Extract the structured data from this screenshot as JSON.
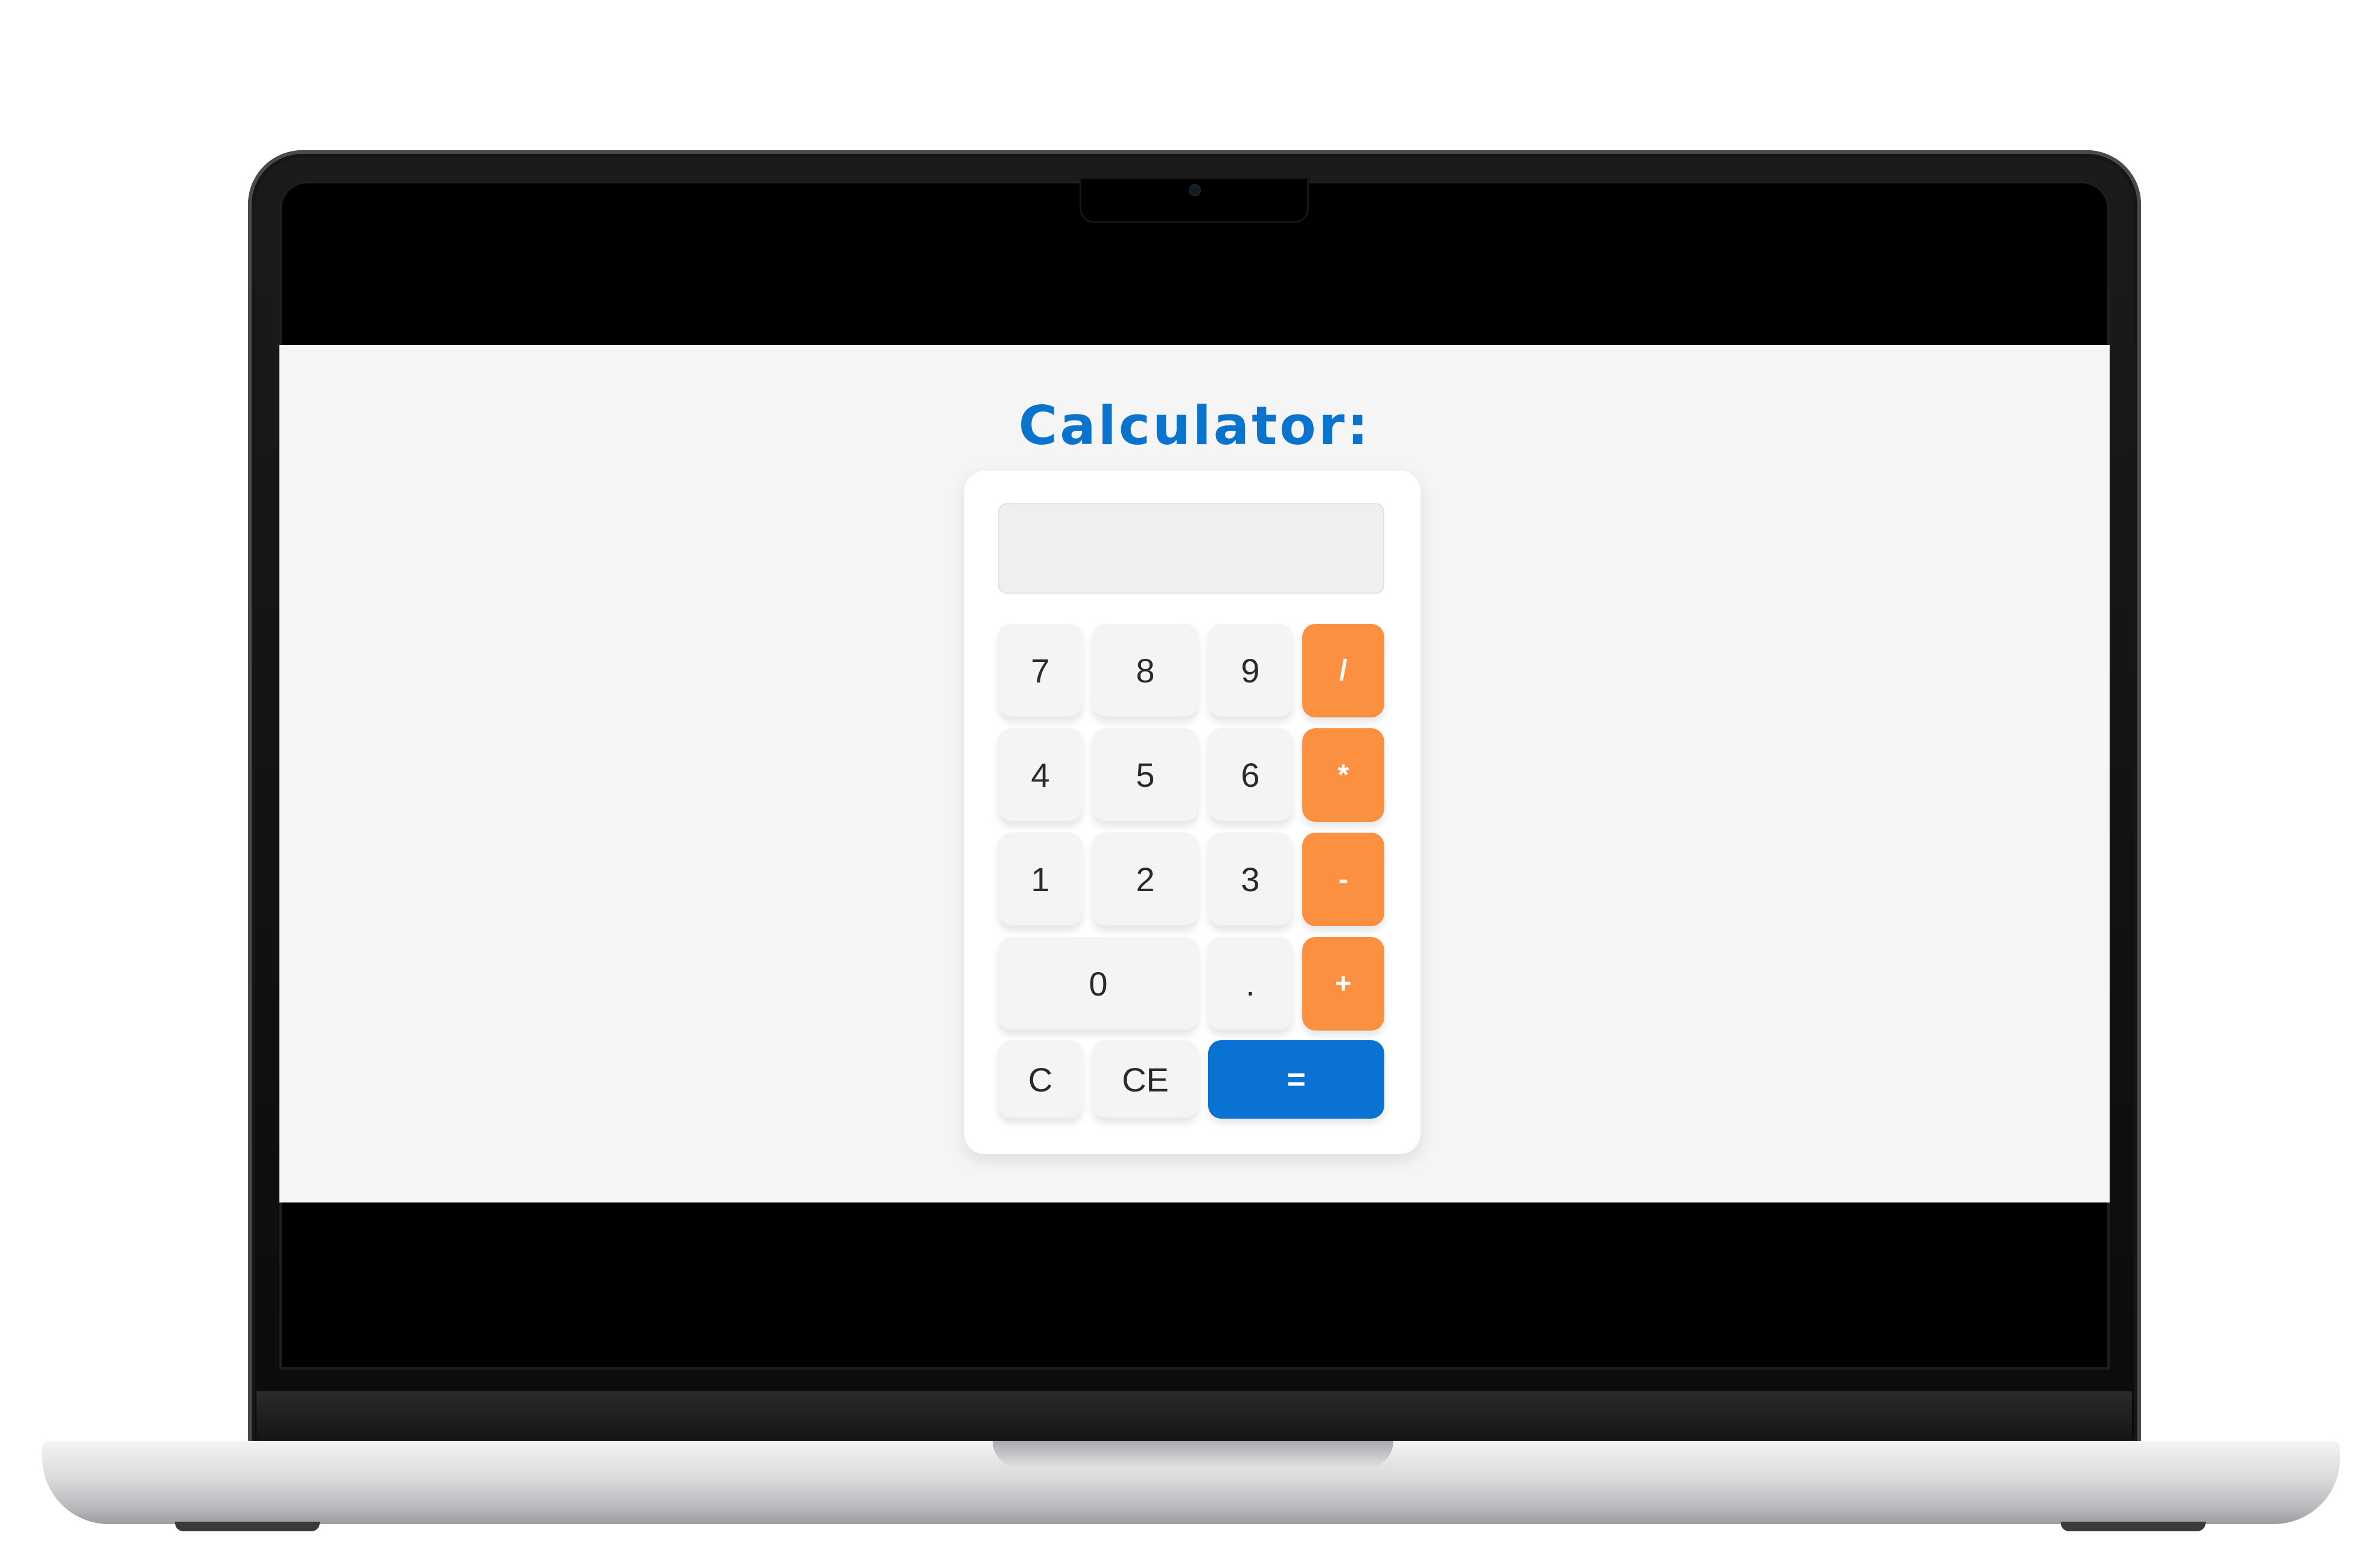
{
  "app": {
    "title": "Calculator:",
    "display": {
      "value": ""
    }
  },
  "keys": {
    "k7": "7",
    "k8": "8",
    "k9": "9",
    "div": "/",
    "k4": "4",
    "k5": "5",
    "k6": "6",
    "mul": "*",
    "k1": "1",
    "k2": "2",
    "k3": "3",
    "sub": "-",
    "k0": "0",
    "dot": ".",
    "add": "+",
    "clear": "C",
    "clear_entry": "CE",
    "equals": "="
  },
  "colors": {
    "title": "#0a73ce",
    "operator": "#fb9140",
    "equals": "#0a72d2",
    "digit": "#f4f4f4"
  }
}
